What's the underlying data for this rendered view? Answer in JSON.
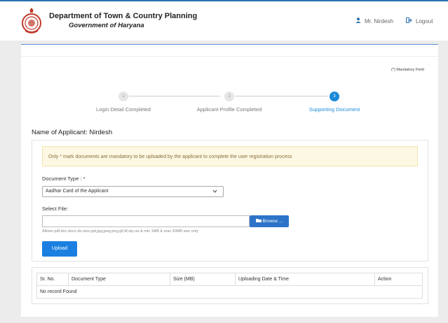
{
  "header": {
    "department": "Department of Town & Country Planning",
    "government": "Government of Haryana",
    "user_name": "Mr. Nirdesh",
    "logout_label": "Logout"
  },
  "mandatory_note": "(*) Mandatory Field",
  "steps": [
    {
      "number": "1",
      "label": "Login Detail Completed",
      "active": false
    },
    {
      "number": "2",
      "label": "Applicant Profile Completed",
      "active": false
    },
    {
      "number": "3",
      "label": "Supporting Document",
      "active": true
    }
  ],
  "applicant_label": "Name of Applicant: Nirdesh",
  "alert_text": "Only * mark documents are mandatory to be uploaded by the applicant to complete the user registration process",
  "form": {
    "document_type_label": "Document Type : *",
    "document_type_value": "Aadhar Card of the Applicant",
    "select_file_label": "Select File:",
    "browse_label": "Browse ...",
    "allows_text": "Allows pdf,doc,docx,xls,xlsx,ppt,jpg,jpeg,png,gif,tif,zip,rar & min 1MB & max 20MB size only",
    "upload_label": "Upload"
  },
  "table": {
    "columns": [
      "Sr. No.",
      "Document Type",
      "Size (MB)",
      "Uploading Date & Time",
      "Action"
    ],
    "empty_text": "No record Found"
  },
  "colors": {
    "accent": "#1a8ad9",
    "button": "#1a7fe0",
    "alert_bg": "#fcf8e3"
  }
}
